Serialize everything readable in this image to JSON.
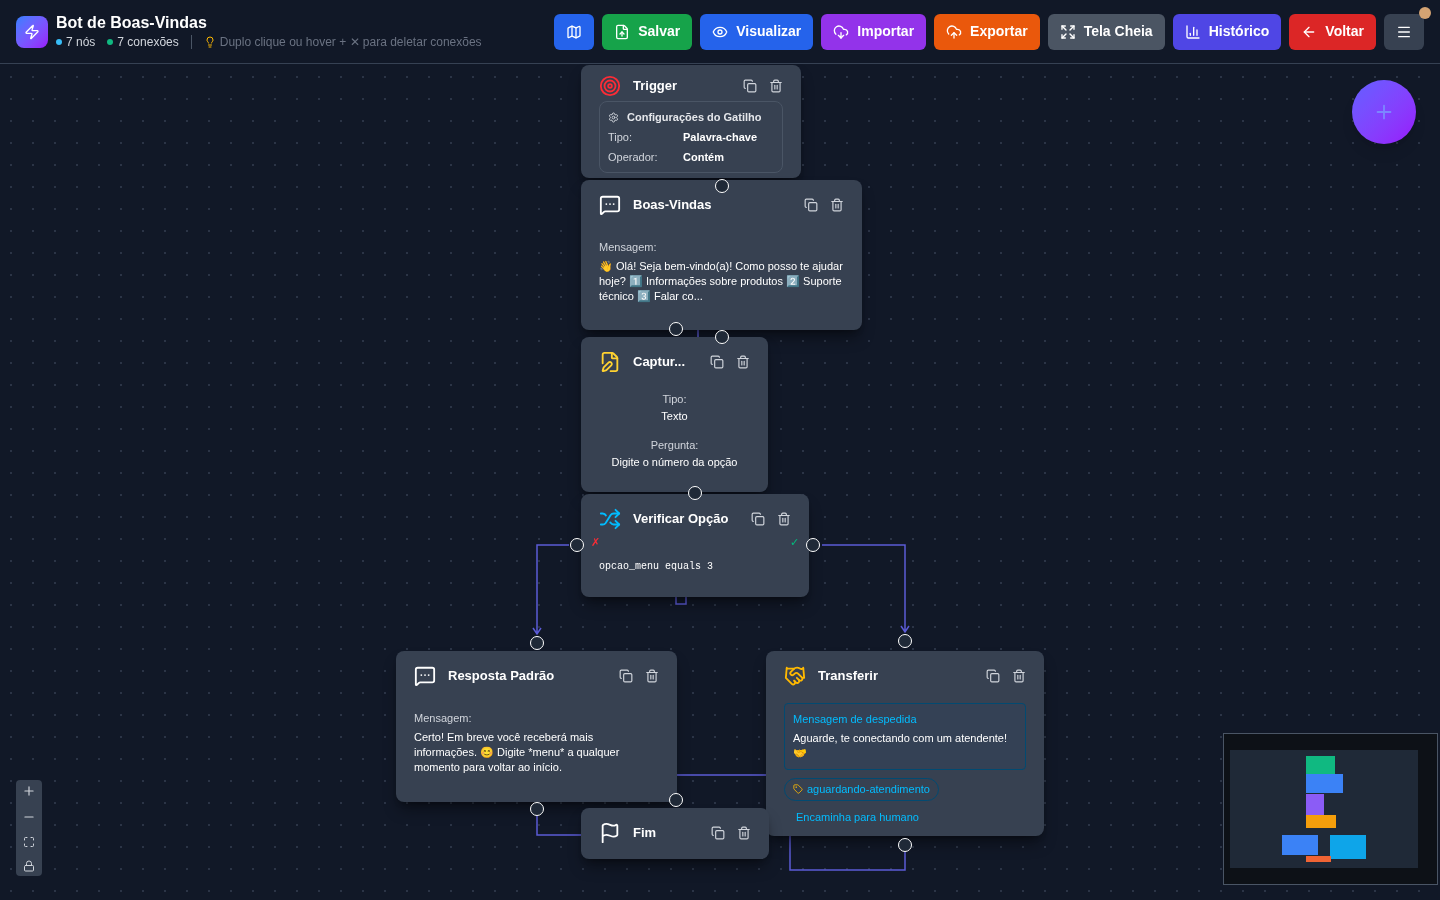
{
  "header": {
    "title": "Bot de Boas-Vindas",
    "stats": [
      {
        "text": "7 nós",
        "color": "#38bdf8"
      },
      {
        "text": "7 conexões",
        "color": "#10b981"
      }
    ],
    "hint": "Duplo clique ou hover + ✕ para deletar conexões"
  },
  "toolbar": [
    {
      "kind": "map",
      "color": "#2563eb"
    },
    {
      "kind": "save",
      "label": "Salvar",
      "color": "#16a34a"
    },
    {
      "kind": "view",
      "label": "Visualizar",
      "color": "#2563eb"
    },
    {
      "kind": "import",
      "label": "Importar",
      "color": "#9333ea"
    },
    {
      "kind": "export",
      "label": "Exportar",
      "color": "#ea580c"
    },
    {
      "kind": "fullscreen",
      "label": "Tela Cheia",
      "color": "#4b5563"
    },
    {
      "kind": "history",
      "label": "Histórico",
      "color": "#4f46e5"
    },
    {
      "kind": "back",
      "label": "Voltar",
      "color": "#dc2626"
    },
    {
      "kind": "menu",
      "color": "#374151",
      "notification": true
    }
  ],
  "nodes": [
    {
      "kind": "trigger",
      "title": "Trigger",
      "config_title": "Configurações do Gatilho",
      "fields": [
        {
          "label": "Tipo:",
          "value": "Palavra-chave"
        },
        {
          "label": "Operador:",
          "value": "Contém"
        }
      ]
    },
    {
      "kind": "message",
      "title": "Boas-Vindas",
      "label": "Mensagem:",
      "text": "👋 Olá! Seja bem-vindo(a)! Como posso te ajudar hoje? 1️⃣ Informações sobre produtos 2️⃣ Suporte técnico 3️⃣ Falar co..."
    },
    {
      "kind": "capture",
      "title": "Captur...",
      "fields": [
        {
          "label": "Tipo:",
          "value": "Texto"
        },
        {
          "label": "Pergunta:",
          "value": "Digite o número da opção"
        }
      ]
    },
    {
      "kind": "condition",
      "title": "Verificar Opção",
      "false_mark": "✗",
      "true_mark": "✓",
      "expression": "opcao_menu equals 3"
    },
    {
      "kind": "message",
      "title": "Resposta Padrão",
      "label": "Mensagem:",
      "text": "Certo! Em breve você receberá mais informações. 😊 Digite *menu* a qualquer momento para voltar ao início."
    },
    {
      "kind": "transfer",
      "title": "Transferir",
      "label": "Mensagem de despedida",
      "text": "Aguarde, te conectando com um atendente! 🤝",
      "tag": "aguardando-atendimento",
      "note": "Encaminha para humano"
    },
    {
      "kind": "end",
      "title": "Fim"
    }
  ]
}
